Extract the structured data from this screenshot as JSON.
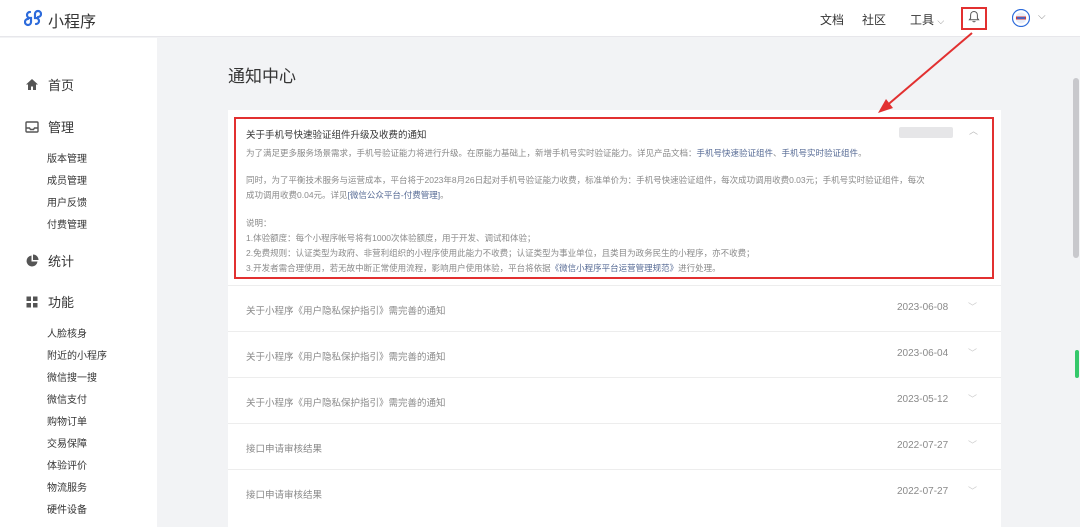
{
  "header": {
    "app_title": "小程序",
    "nav_docs": "文档",
    "nav_community": "社区",
    "nav_tools": "工具",
    "bell_icon": "bell-icon",
    "accent_red": "#e23030"
  },
  "sidebar": {
    "home": "首页",
    "manage": "管理",
    "manage_items": [
      "版本管理",
      "成员管理",
      "用户反馈",
      "付费管理"
    ],
    "stats": "统计",
    "functions": "功能",
    "function_items": [
      "人脸核身",
      "附近的小程序",
      "微信搜一搜",
      "微信支付",
      "购物订单",
      "交易保障",
      "体验评价",
      "物流服务",
      "硬件设备"
    ]
  },
  "main": {
    "title": "通知中心",
    "open_notice": {
      "title": "关于手机号快速验证组件升级及收费的通知",
      "p1": "为了满足更多服务场景需求，手机号验证能力将进行升级。在原能力基础上，新增手机号实时验证能力。详见产品文档：",
      "p1_link1": "手机号快速验证组件",
      "p1_sep": "、",
      "p1_link2": "手机号实时验证组件",
      "p1_end": "。",
      "p2_a": "同时，为了平衡技术服务与运营成本，平台将于2023年8月26日起对手机号验证能力收费，标准单价为：手机号快速验证组件，每次成功调用收费0.03元；手机号实时验证组件，每次",
      "p2_b": "成功调用收费0.04元。详见",
      "p2_link": "[微信公众平台-付费管理]",
      "p2_end": "。",
      "n0": "说明：",
      "n1": "1.体验额度：每个小程序帐号将有1000次体验额度，用于开发、调试和体验；",
      "n2": "2.免费规则：认证类型为政府、非营利组织的小程序使用此能力不收费；认证类型为事业单位，且类目为政务民生的小程序，亦不收费；",
      "n3_a": "3.开发者需合理使用，若无故中断正常使用流程，影响用户使用体验，平台将依据",
      "n3_link": "《微信小程序平台运营管理规范》",
      "n3_end": "进行处理。"
    },
    "notices": [
      {
        "title": "关于小程序《用户隐私保护指引》需完善的通知",
        "date": "2023-06-08"
      },
      {
        "title": "关于小程序《用户隐私保护指引》需完善的通知",
        "date": "2023-06-04"
      },
      {
        "title": "关于小程序《用户隐私保护指引》需完善的通知",
        "date": "2023-05-12"
      },
      {
        "title": "接口申请审核结果",
        "date": "2022-07-27"
      },
      {
        "title": "接口申请审核结果",
        "date": "2022-07-27"
      }
    ]
  }
}
